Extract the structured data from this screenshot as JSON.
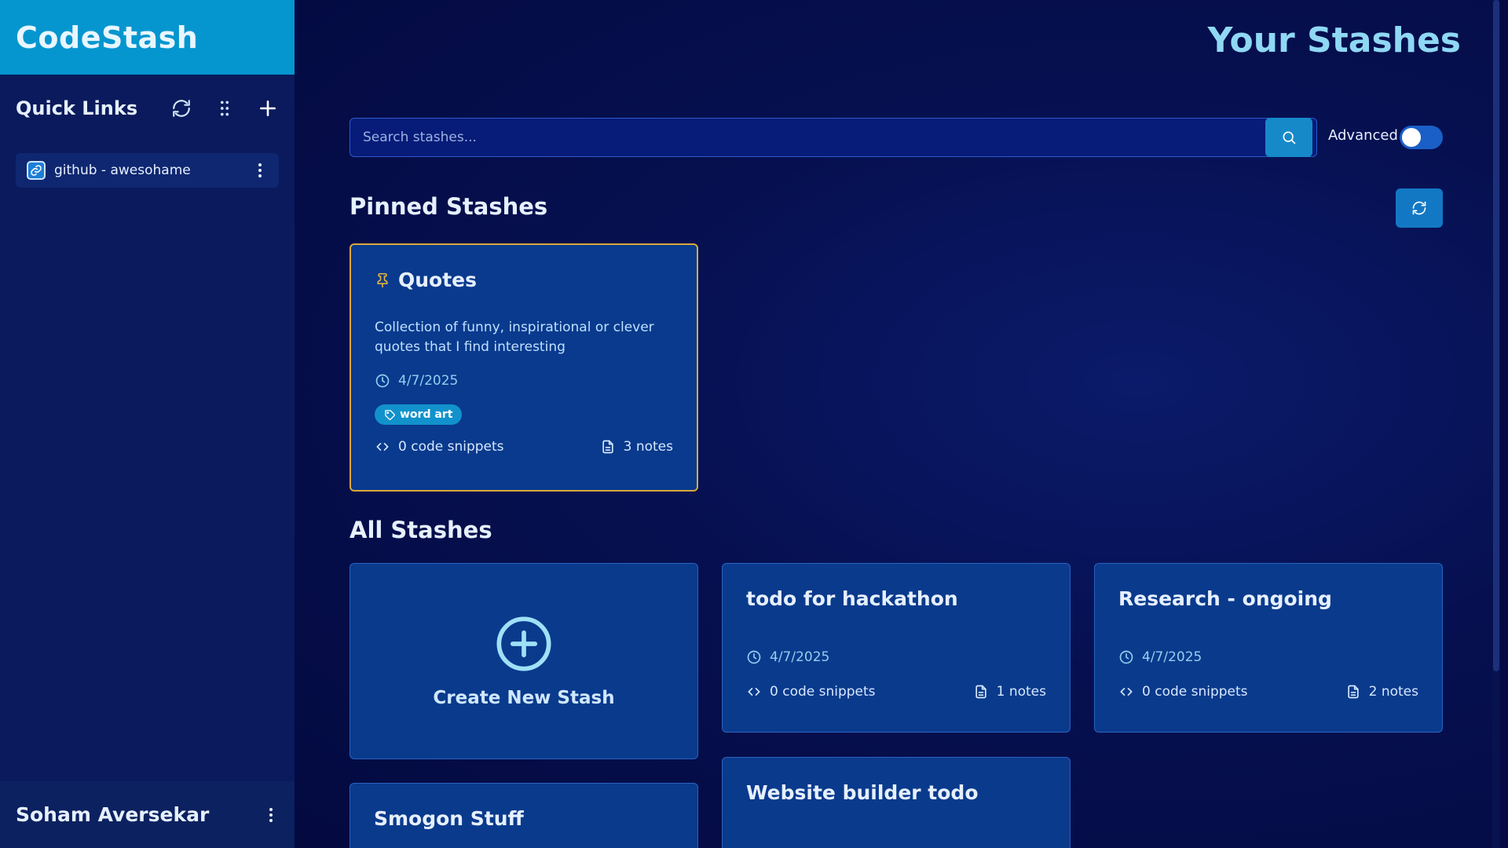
{
  "app": {
    "name": "CodeStash"
  },
  "sidebar": {
    "quick_links_title": "Quick Links",
    "links": [
      {
        "label": "github - awesohame"
      }
    ],
    "user_name": "Soham Aversekar"
  },
  "header": {
    "title": "Your Stashes"
  },
  "search": {
    "placeholder": "Search stashes...",
    "value": "",
    "advanced_label": "Advanced",
    "advanced_on": false
  },
  "pinned": {
    "title": "Pinned Stashes",
    "cards": [
      {
        "title": "Quotes",
        "description": "Collection of funny, inspirational or clever quotes that I find interesting",
        "date": "4/7/2025",
        "tag": "word art",
        "snippets": "0 code snippets",
        "notes": "3 notes"
      }
    ]
  },
  "all": {
    "title": "All Stashes",
    "create_label": "Create New Stash",
    "cards": [
      {
        "title": "todo for hackathon",
        "date": "4/7/2025",
        "snippets": "0 code snippets",
        "notes": "1 notes"
      },
      {
        "title": "Research - ongoing",
        "date": "4/7/2025",
        "snippets": "0 code snippets",
        "notes": "2 notes"
      },
      {
        "title": "Website builder todo"
      },
      {
        "title": "Smogon Stuff"
      }
    ]
  },
  "colors": {
    "brand": "#0596cf",
    "background": "#050a44",
    "card": "#0a3a8c",
    "pinned_border": "#d8a93a",
    "accent_blue": "#1689c9",
    "title_cyan": "#8fd8f4"
  }
}
